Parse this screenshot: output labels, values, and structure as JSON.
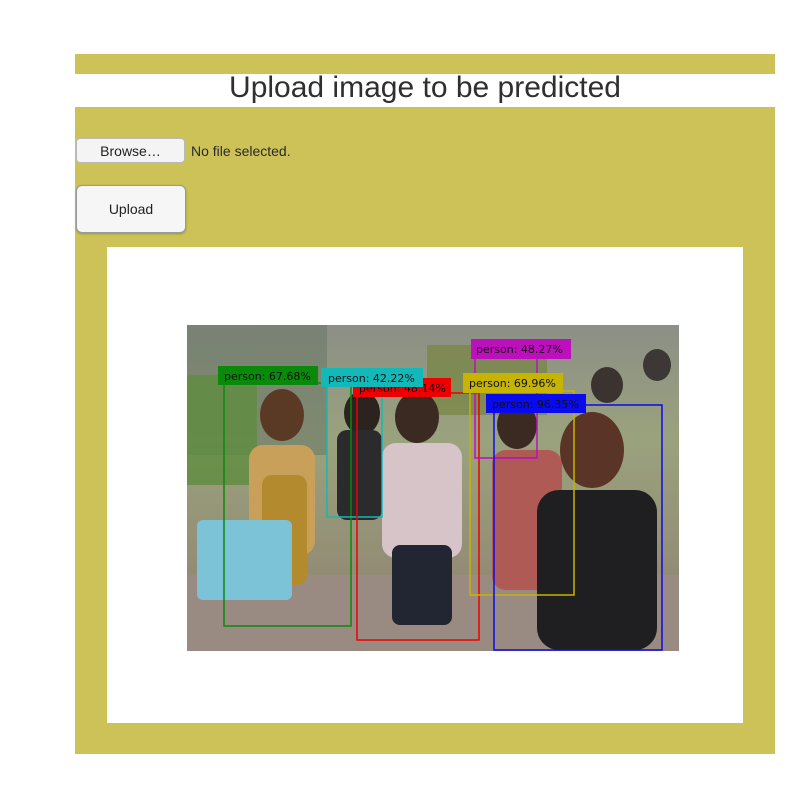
{
  "header": {
    "title": "Upload image to be predicted"
  },
  "form": {
    "browse_label": "Browse…",
    "file_status": "No file selected.",
    "upload_label": "Upload"
  },
  "result": {
    "detections": [
      {
        "label": "person: 67.68%",
        "color": "#0a8a0a"
      },
      {
        "label": "person: 42.22%",
        "color": "#13b8b8"
      },
      {
        "label": "person: 48.14%",
        "color": "#ee0000"
      },
      {
        "label": "person: 48.27%",
        "color": "#bb10bb"
      },
      {
        "label": "person: 69.96%",
        "color": "#c6b400"
      },
      {
        "label": "person: 96.35%",
        "color": "#0a0aee"
      }
    ]
  },
  "colors": {
    "panel": "#cdc257",
    "frame": "#ffffff"
  }
}
